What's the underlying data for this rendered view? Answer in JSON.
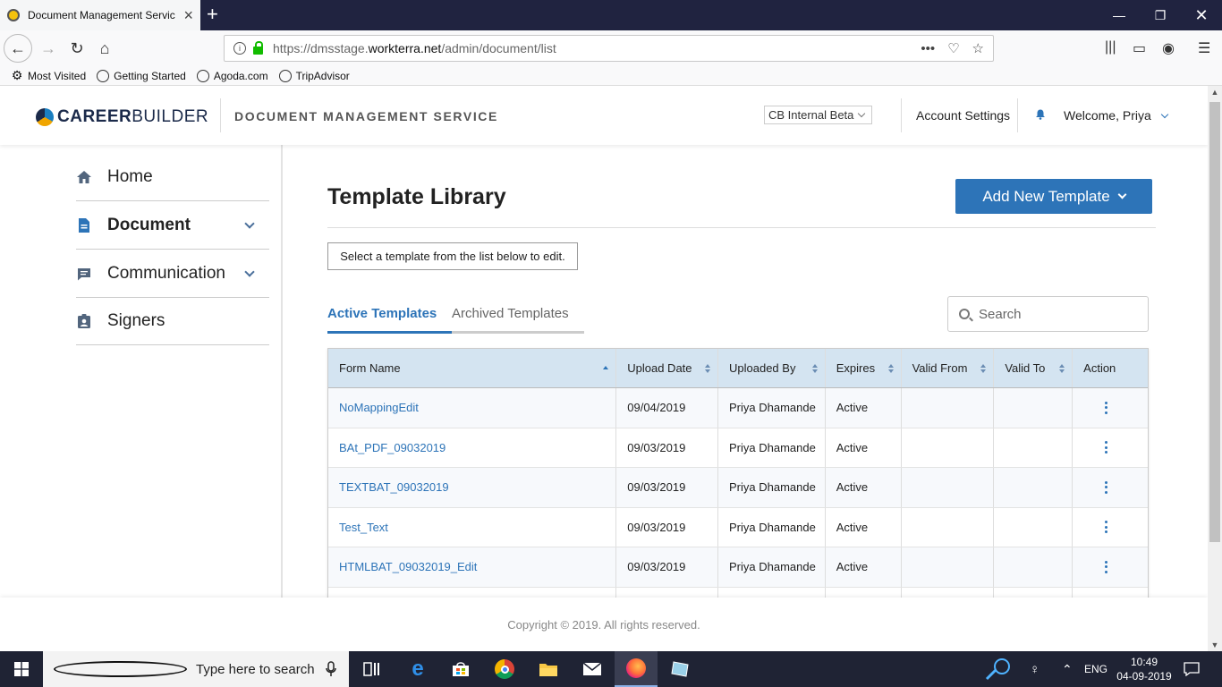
{
  "browser": {
    "tab_title": "Document Management Servic",
    "url_prefix": "https://dmsstage.",
    "url_domain": "workterra.net",
    "url_path": "/admin/document/list",
    "bookmarks": [
      {
        "label": "Most Visited",
        "icon": "gear-icon"
      },
      {
        "label": "Getting Started",
        "icon": "globe-icon"
      },
      {
        "label": "Agoda.com",
        "icon": "globe-icon"
      },
      {
        "label": "TripAdvisor",
        "icon": "globe-icon"
      }
    ]
  },
  "header": {
    "logo_career": "CAREER",
    "logo_builder": "BUILDER",
    "service_name": "DOCUMENT MANAGEMENT SERVICE",
    "environment": "CB Internal Beta",
    "account_settings": "Account Settings",
    "welcome": "Welcome, Priya"
  },
  "sidebar": {
    "items": [
      {
        "label": "Home",
        "icon": "home-icon"
      },
      {
        "label": "Document",
        "icon": "document-icon"
      },
      {
        "label": "Communication",
        "icon": "chat-icon"
      },
      {
        "label": "Signers",
        "icon": "badge-icon"
      }
    ]
  },
  "main": {
    "title": "Template Library",
    "add_button": "Add New Template",
    "hint": "Select a template from the list below to edit.",
    "tabs": [
      {
        "label": "Active Templates",
        "active": true
      },
      {
        "label": "Archived Templates",
        "active": false
      }
    ],
    "search_placeholder": "Search",
    "columns": [
      "Form Name",
      "Upload Date",
      "Uploaded By",
      "Expires",
      "Valid From",
      "Valid To",
      "Action"
    ],
    "rows": [
      {
        "name": "NoMappingEdit",
        "date": "09/04/2019",
        "by": "Priya Dhamande",
        "expires": "Active",
        "from": "",
        "to": ""
      },
      {
        "name": "BAt_PDF_09032019",
        "date": "09/03/2019",
        "by": "Priya Dhamande",
        "expires": "Active",
        "from": "",
        "to": ""
      },
      {
        "name": "TEXTBAT_09032019",
        "date": "09/03/2019",
        "by": "Priya Dhamande",
        "expires": "Active",
        "from": "",
        "to": ""
      },
      {
        "name": "Test_Text",
        "date": "09/03/2019",
        "by": "Priya Dhamande",
        "expires": "Active",
        "from": "",
        "to": ""
      },
      {
        "name": "HTMLBAT_09032019_Edit",
        "date": "09/03/2019",
        "by": "Priya Dhamande",
        "expires": "Active",
        "from": "",
        "to": ""
      }
    ]
  },
  "footer": {
    "copyright": "Copyright © 2019. All rights reserved."
  },
  "taskbar": {
    "search_placeholder": "Type here to search",
    "language": "ENG",
    "time": "10:49",
    "date": "04-09-2019"
  },
  "colors": {
    "brand_blue": "#2d74b8",
    "table_header": "#d4e4f1",
    "taskbar": "#1f2334"
  }
}
